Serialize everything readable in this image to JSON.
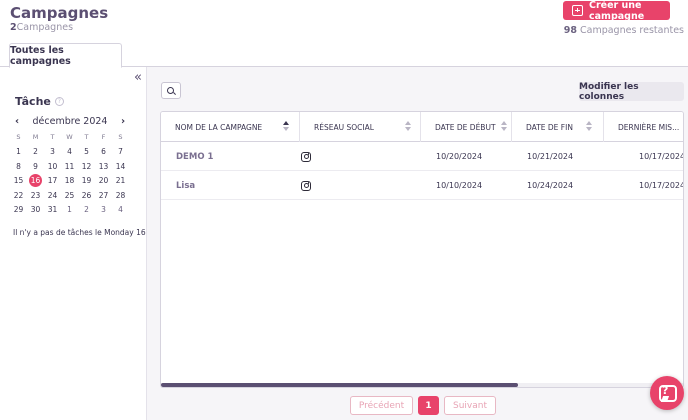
{
  "header": {
    "title": "Campagnes",
    "count_number": "2",
    "count_label": "Campagnes",
    "create_label": "Créer une campagne",
    "remaining_number": "98",
    "remaining_label": "Campagnes restantes"
  },
  "tabs": [
    {
      "label": "Toutes les campagnes",
      "active": true
    }
  ],
  "sidebar": {
    "task_title": "Tâche",
    "calendar": {
      "month_label": "décembre 2024",
      "weekdays": [
        "S",
        "M",
        "T",
        "W",
        "T",
        "F",
        "S"
      ],
      "weeks": [
        [
          "1",
          "2",
          "3",
          "4",
          "5",
          "6",
          "7"
        ],
        [
          "8",
          "9",
          "10",
          "11",
          "12",
          "13",
          "14"
        ],
        [
          "15",
          "16",
          "17",
          "18",
          "19",
          "20",
          "21"
        ],
        [
          "22",
          "23",
          "24",
          "25",
          "26",
          "27",
          "28"
        ],
        [
          "29",
          "30",
          "31",
          "1",
          "2",
          "3",
          "4"
        ]
      ],
      "selected_day": "16"
    },
    "no_task_text": "Il n'y a pas de tâches le Monday 16"
  },
  "toolbar": {
    "modify_columns_label": "Modifier les colonnes"
  },
  "table": {
    "columns": [
      "NOM DE LA CAMPAGNE",
      "RÉSEAU SOCIAL",
      "DATE DE DÉBUT",
      "DATE DE FIN",
      "DERNIÈRE MIS..."
    ],
    "rows": [
      {
        "name": "DEMO 1",
        "network_icon": "instagram-icon",
        "start": "10/20/2024",
        "end": "10/21/2024",
        "updated": "10/17/2024"
      },
      {
        "name": "Lisa",
        "network_icon": "instagram-icon",
        "start": "10/10/2024",
        "end": "10/24/2024",
        "updated": "10/17/2024"
      }
    ]
  },
  "pagination": {
    "prev_label": "Précédent",
    "current_page": "1",
    "next_label": "Suivant"
  },
  "colors": {
    "accent": "#e8436a",
    "brand_purple": "#5b4f72"
  }
}
